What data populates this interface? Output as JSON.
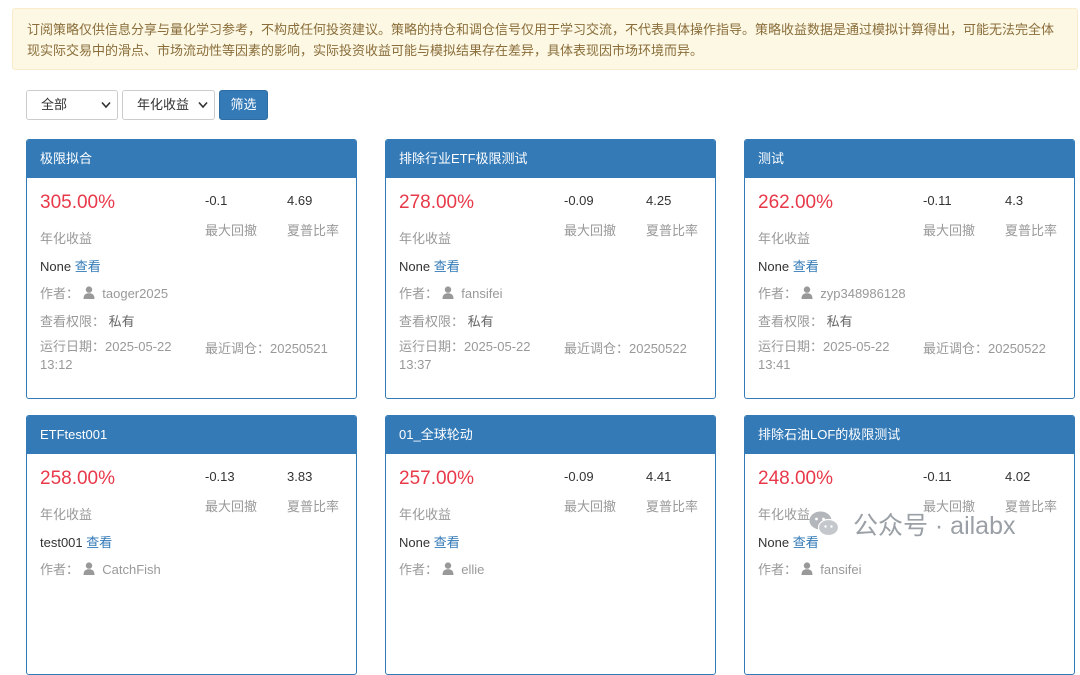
{
  "notice": "订阅策略仅供信息分享与量化学习参考，不构成任何投资建议。策略的持仓和调仓信号仅用于学习交流，不代表具体操作指导。策略收益数据是通过模拟计算得出，可能无法完全体现实际交易中的滑点、市场流动性等因素的影响，实际投资收益可能与模拟结果存在差异，具体表现因市场环境而异。",
  "filters": {
    "category_selected": "全部",
    "sort_selected": "年化收益",
    "filter_button": "筛选"
  },
  "labels": {
    "annual_return": "年化收益",
    "max_drawdown": "最大回撤",
    "sharpe": "夏普比率",
    "view": "查看",
    "author_prefix": "作者：",
    "permission_prefix": "查看权限：",
    "run_date_prefix": "运行日期：",
    "recent_rebalance_prefix": "最近调仓："
  },
  "cards": [
    {
      "title": "极限拟合",
      "annual_return": "305.00%",
      "max_drawdown": "-0.1",
      "sharpe": "4.69",
      "desc": "None",
      "author": "taoger2025",
      "permission": "私有",
      "run_date": "2025-05-22 13:12",
      "recent_rebalance": "20250521"
    },
    {
      "title": "排除行业ETF极限测试",
      "annual_return": "278.00%",
      "max_drawdown": "-0.09",
      "sharpe": "4.25",
      "desc": "None",
      "author": "fansifei",
      "permission": "私有",
      "run_date": "2025-05-22 13:37",
      "recent_rebalance": "20250522"
    },
    {
      "title": "测试",
      "annual_return": "262.00%",
      "max_drawdown": "-0.11",
      "sharpe": "4.3",
      "desc": "None",
      "author": "zyp348986128",
      "permission": "私有",
      "run_date": "2025-05-22 13:41",
      "recent_rebalance": "20250522"
    },
    {
      "title": "ETFtest001",
      "annual_return": "258.00%",
      "max_drawdown": "-0.13",
      "sharpe": "3.83",
      "desc": "test001",
      "author": "CatchFish",
      "permission": "",
      "run_date": "",
      "recent_rebalance": ""
    },
    {
      "title": "01_全球轮动",
      "annual_return": "257.00%",
      "max_drawdown": "-0.09",
      "sharpe": "4.41",
      "desc": "None",
      "author": "ellie",
      "permission": "",
      "run_date": "",
      "recent_rebalance": ""
    },
    {
      "title": "排除石油LOF的极限测试",
      "annual_return": "248.00%",
      "max_drawdown": "-0.11",
      "sharpe": "4.02",
      "desc": "None",
      "author": "fansifei",
      "permission": "",
      "run_date": "",
      "recent_rebalance": ""
    }
  ],
  "watermark": {
    "text": "公众号 · ailabx",
    "icon": "wechat-icon"
  },
  "colors": {
    "primary": "#337ab7",
    "return_red": "#e8394a",
    "notice_bg": "#fcf8e3",
    "notice_text": "#8a6d3b"
  }
}
